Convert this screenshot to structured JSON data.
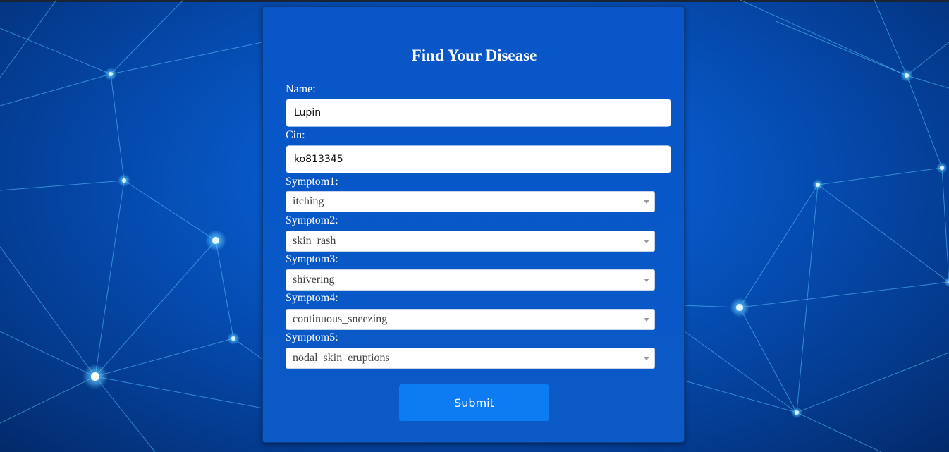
{
  "form": {
    "title": "Find Your Disease",
    "name_label": "Name:",
    "name_value": "Lupin",
    "cin_label": "Cin:",
    "cin_value": "ko813345",
    "symptoms": [
      {
        "label": "Symptom1:",
        "value": "itching"
      },
      {
        "label": "Symptom2:",
        "value": "skin_rash"
      },
      {
        "label": "Symptom3:",
        "value": "shivering"
      },
      {
        "label": "Symptom4:",
        "value": "continuous_sneezing"
      },
      {
        "label": "Symptom5:",
        "value": "nodal_skin_eruptions"
      }
    ],
    "submit_label": "Submit"
  },
  "colors": {
    "background": "#0656c4",
    "card": "#0757c9",
    "button": "#0d7cf2",
    "network_line": "#5ec8ff"
  },
  "icons": {
    "select_caret": "caret-down-icon",
    "network_node": "glowing-node-icon"
  }
}
